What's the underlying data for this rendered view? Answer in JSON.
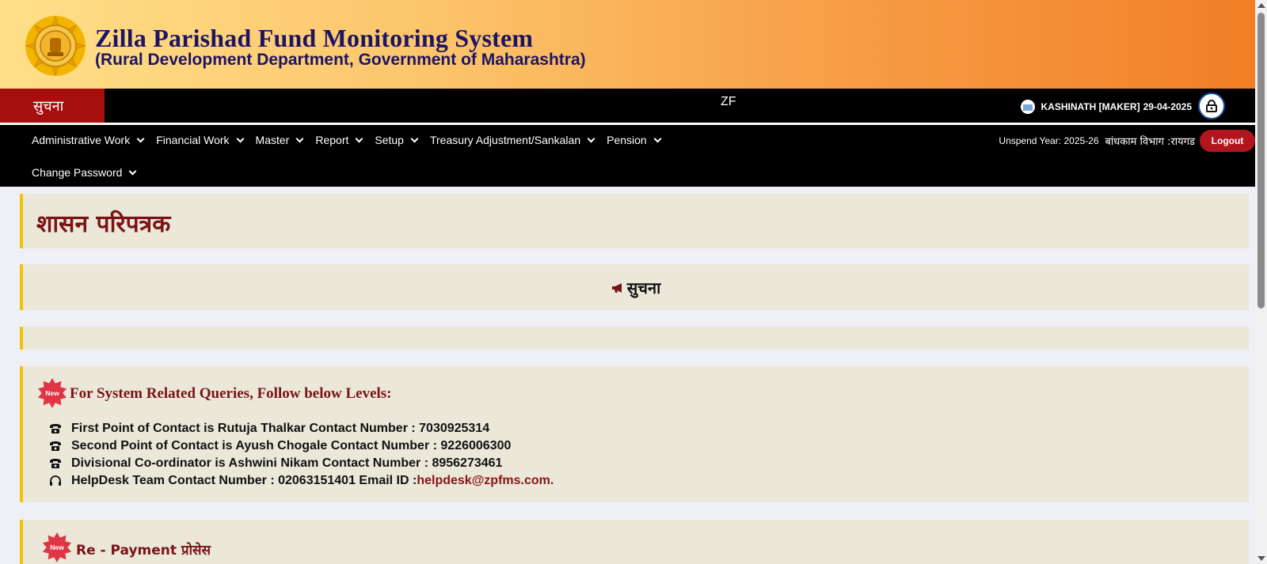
{
  "header": {
    "title": "Zilla Parishad Fund Monitoring System",
    "subtitle": "(Rural Development Department, Government of Maharashtra)"
  },
  "noticebar": {
    "label": "सुचना",
    "marquee": "ZF",
    "user": "KASHINATH [MAKER]",
    "date": "29-04-2025"
  },
  "nav": {
    "items": [
      {
        "label": "Administrative Work"
      },
      {
        "label": "Financial Work"
      },
      {
        "label": "Master"
      },
      {
        "label": "Report"
      },
      {
        "label": "Setup"
      },
      {
        "label": "Treasury Adjustment/Sankalan"
      },
      {
        "label": "Pension"
      }
    ],
    "change_password": "Change Password",
    "unspend_year": "Unspend Year: 2025-26",
    "department": "बांधकाम विभाग :रायगड",
    "logout": "Logout"
  },
  "content": {
    "page_heading": "शासन परिपत्रक",
    "suchana_title": "सुचना",
    "queries_title": "For System Related Queries, Follow below Levels:",
    "new_badge": "New",
    "contacts": [
      {
        "text": "First Point of Contact is Rutuja Thalkar  Contact Number : 7030925314",
        "icon": "phone-icon"
      },
      {
        "text": "Second Point of Contact is Ayush Chogale  Contact Number : 9226006300",
        "icon": "phone-icon"
      },
      {
        "text": "Divisional Co-ordinator is Ashwini Nikam  Contact Number : 8956273461",
        "icon": "phone-icon"
      },
      {
        "text": "HelpDesk  Team Contact Number : 02063151401  Email ID : ",
        "email": "helpdesk@zpfms.com",
        "icon": "headset-icon"
      }
    ],
    "repayment_title": "Re - Payment प्रोसेस"
  },
  "colors": {
    "accent_yellow": "#f2c20a",
    "maroon": "#7a1316",
    "logout_red": "#b2151d",
    "panel_bg": "#ebe7d9"
  }
}
